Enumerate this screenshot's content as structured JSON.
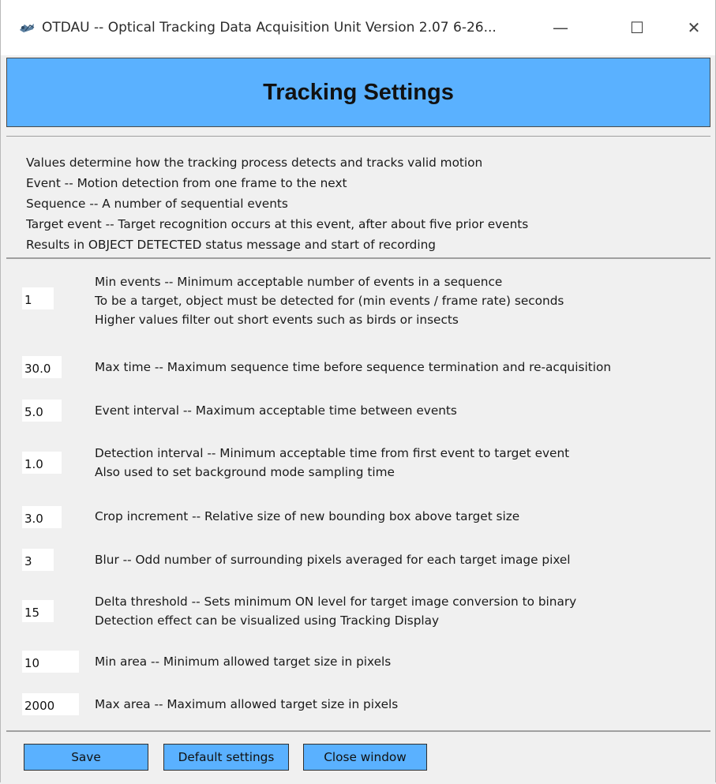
{
  "window": {
    "title": "OTDAU -- Optical Tracking Data Acquisition Unit   Version 2.07  6-26...",
    "icon": "otdau-app-icon",
    "controls": {
      "minimize": "—",
      "maximize": "☐",
      "close": "✕"
    }
  },
  "banner": {
    "title": "Tracking Settings",
    "color": "#5ab1ff"
  },
  "info": {
    "lines": [
      "Values determine how the tracking process detects and tracks valid motion",
      "Event -- Motion detection from one frame to the next",
      "Sequence -- A number of sequential events",
      "Target event -- Target recognition occurs at this event, after about five prior events",
      "Results in OBJECT DETECTED status message and start of recording"
    ]
  },
  "settings": [
    {
      "value": "1",
      "lines": [
        "Min events -- Minimum acceptable number of events in a sequence",
        "To be a target, object must be detected for (min events / frame rate) seconds",
        "Higher values filter out short events such as birds or insects"
      ]
    },
    {
      "value": "30.0",
      "lines": [
        "Max time -- Maximum sequence time before sequence termination and re-acquisition"
      ]
    },
    {
      "value": "5.0",
      "lines": [
        "Event interval -- Maximum acceptable time between events"
      ]
    },
    {
      "value": "1.0",
      "lines": [
        "Detection interval -- Minimum acceptable time from first event to target event",
        "Also used to set background mode sampling time"
      ]
    },
    {
      "value": "3.0",
      "lines": [
        "Crop increment -- Relative size of new bounding box above target size"
      ]
    },
    {
      "value": "3",
      "lines": [
        "Blur -- Odd number of surrounding pixels averaged for each target image pixel"
      ]
    },
    {
      "value": "15",
      "lines": [
        "Delta threshold -- Sets minimum ON level for target image conversion to binary",
        "Detection effect can be visualized using Tracking Display"
      ]
    },
    {
      "value": "10",
      "lines": [
        "Min area -- Minimum allowed target size in pixels"
      ]
    },
    {
      "value": "2000",
      "lines": [
        "Max area -- Maximum allowed target size in pixels"
      ]
    }
  ],
  "buttons": {
    "save": "Save",
    "default": "Default settings",
    "close": "Close window"
  }
}
